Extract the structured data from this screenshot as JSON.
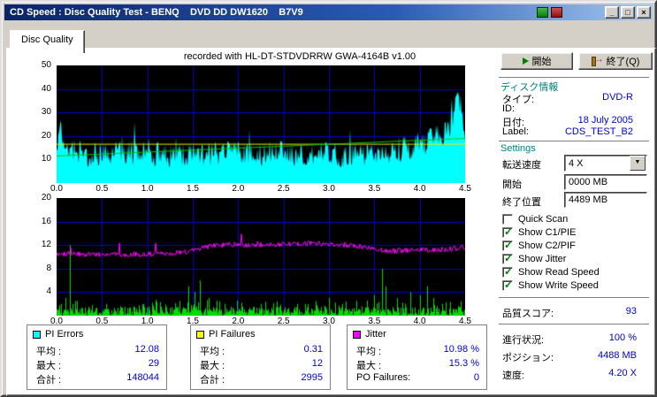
{
  "window": {
    "title": "CD Speed : Disc Quality Test - BENQ    DVD DD DW1620    B7V9"
  },
  "icons": {
    "minimize": "_",
    "maximize": "□",
    "close": "×",
    "dropdown": "▼",
    "check": "✓"
  },
  "tab": {
    "label": "Disc Quality"
  },
  "recorded_with": "recorded with HL-DT-STDVDRRW GWA-4164B v1.00",
  "buttons": {
    "start": "開始",
    "exit": "終了(Q)"
  },
  "disc_info": {
    "header": "ディスク情報",
    "rows": [
      {
        "label": "タイプ:",
        "value": "DVD-R"
      },
      {
        "label": "ID:",
        "value": ""
      },
      {
        "label": "日付:",
        "value": "18 July 2005"
      },
      {
        "label": "Label:",
        "value": "CDS_TEST_B2"
      }
    ]
  },
  "settings": {
    "header": "Settings",
    "speed_label": "転送速度",
    "speed_value": "4 X",
    "start_label": "開始",
    "start_value": "0000 MB",
    "end_label": "終了位置",
    "end_value": "4489 MB",
    "checkboxes": [
      {
        "label": "Quick Scan",
        "checked": false
      },
      {
        "label": "Show C1/PIE",
        "checked": true
      },
      {
        "label": "Show C2/PIF",
        "checked": true
      },
      {
        "label": "Show Jitter",
        "checked": true
      },
      {
        "label": "Show Read Speed",
        "checked": true
      },
      {
        "label": "Show Write Speed",
        "checked": true
      }
    ]
  },
  "quality": {
    "label": "品質スコア:",
    "value": "93"
  },
  "progress": {
    "rows": [
      {
        "label": "進行状況:",
        "value": "100 %"
      },
      {
        "label": "ポジション:",
        "value": "4488 MB"
      },
      {
        "label": "速度:",
        "value": "4.20 X"
      }
    ]
  },
  "stats_boxes": [
    {
      "title": "PI Errors",
      "swatch": "#00ffff",
      "rows": [
        {
          "label": "平均 :",
          "value": "12.08"
        },
        {
          "label": "最大 :",
          "value": "29"
        },
        {
          "label": "合計 :",
          "value": "148044"
        }
      ]
    },
    {
      "title": "PI Failures",
      "swatch": "#ffff00",
      "rows": [
        {
          "label": "平均 :",
          "value": "0.31"
        },
        {
          "label": "最大 :",
          "value": "12"
        },
        {
          "label": "合計 :",
          "value": "2995"
        }
      ]
    },
    {
      "title": "Jitter",
      "swatch": "#ff00ff",
      "rows": [
        {
          "label": "平均 :",
          "value": "10.98 %"
        },
        {
          "label": "最大 :",
          "value": "15.3 %"
        },
        {
          "label": "PO Failures:",
          "value": "0"
        }
      ]
    }
  ],
  "chart_data": [
    {
      "type": "area",
      "title": "PI Errors vs disc position",
      "x_range": [
        0,
        4.5
      ],
      "y_range": [
        0,
        50
      ],
      "x_ticks": [
        "0.0",
        "0.5",
        "1.0",
        "1.5",
        "2.0",
        "2.5",
        "3.0",
        "3.5",
        "4.0",
        "4.5"
      ],
      "y_ticks": [
        "50",
        "40",
        "30",
        "20",
        "10"
      ],
      "bg": "#000000",
      "grid_color": "#0000c8",
      "grid": true,
      "series": [
        {
          "name": "PI Errors",
          "kind": "noisy-area",
          "color": "#00ffff",
          "seed": 20050718,
          "noise": 5.5,
          "envelope": [
            [
              0,
              15
            ],
            [
              0.05,
              22
            ],
            [
              0.12,
              16
            ],
            [
              0.3,
              12
            ],
            [
              0.6,
              12
            ],
            [
              0.9,
              13
            ],
            [
              1.2,
              12
            ],
            [
              1.5,
              12
            ],
            [
              1.8,
              13
            ],
            [
              2.1,
              12
            ],
            [
              2.4,
              13
            ],
            [
              2.7,
              12
            ],
            [
              3.0,
              12
            ],
            [
              3.3,
              12
            ],
            [
              3.6,
              13
            ],
            [
              3.9,
              15
            ],
            [
              4.1,
              18
            ],
            [
              4.25,
              21
            ],
            [
              4.35,
              24
            ],
            [
              4.42,
              42
            ],
            [
              4.46,
              30
            ],
            [
              4.5,
              22
            ]
          ]
        },
        {
          "name": "Write Speed",
          "kind": "line",
          "color": "#e8e800",
          "points": [
            [
              0,
              16.5
            ],
            [
              4.5,
              16.5
            ]
          ]
        },
        {
          "name": "Read Speed",
          "kind": "line",
          "color": "#00c800",
          "points": [
            [
              0,
              11.5
            ],
            [
              4.5,
              19
            ]
          ]
        }
      ]
    },
    {
      "type": "mixed",
      "title": "PI Failures and Jitter vs disc position",
      "x_range": [
        0,
        4.5
      ],
      "y_range": [
        0,
        20
      ],
      "x_ticks": [
        "0.0",
        "0.5",
        "1.0",
        "1.5",
        "2.0",
        "2.5",
        "3.0",
        "3.5",
        "4.0",
        "4.5"
      ],
      "y_ticks": [
        "20",
        "16",
        "12",
        "8",
        "4"
      ],
      "bg": "#000000",
      "grid_color": "#0000c8",
      "grid": true,
      "series": [
        {
          "name": "PI Failures",
          "kind": "spikes",
          "color": "#00dc00",
          "seed": 41648,
          "grass": 1.5,
          "spikes": [
            [
              0.05,
              2
            ],
            [
              0.1,
              3
            ],
            [
              0.15,
              12
            ],
            [
              0.22,
              2.5
            ],
            [
              0.35,
              1.5
            ],
            [
              0.55,
              2
            ],
            [
              0.75,
              1.5
            ],
            [
              0.95,
              2
            ],
            [
              1.15,
              1.5
            ],
            [
              1.35,
              2.5
            ],
            [
              1.45,
              5
            ],
            [
              1.52,
              4
            ],
            [
              1.58,
              6
            ],
            [
              1.68,
              3
            ],
            [
              1.85,
              2
            ],
            [
              2.05,
              1.5
            ],
            [
              2.25,
              2
            ],
            [
              2.45,
              1.5
            ],
            [
              2.65,
              2
            ],
            [
              2.85,
              2.5
            ],
            [
              3.0,
              3
            ],
            [
              3.15,
              2
            ],
            [
              3.3,
              2.5
            ],
            [
              3.5,
              3.5
            ],
            [
              3.58,
              8
            ],
            [
              3.62,
              5
            ],
            [
              3.75,
              3
            ],
            [
              3.9,
              4
            ],
            [
              4.0,
              3.5
            ],
            [
              4.08,
              5
            ],
            [
              4.15,
              3
            ],
            [
              4.25,
              2
            ]
          ]
        },
        {
          "name": "Jitter",
          "kind": "noisy-line",
          "color": "#ff00ff",
          "seed": 1098,
          "noise": 0.9,
          "envelope": [
            [
              0,
              10.6
            ],
            [
              0.3,
              10.4
            ],
            [
              0.6,
              10.5
            ],
            [
              0.9,
              10.4
            ],
            [
              1.2,
              10.5
            ],
            [
              1.45,
              10.9
            ],
            [
              1.7,
              11.8
            ],
            [
              1.9,
              12.1
            ],
            [
              2.2,
              12.0
            ],
            [
              2.5,
              12.2
            ],
            [
              2.8,
              12.3
            ],
            [
              3.1,
              12.1
            ],
            [
              3.3,
              11.9
            ],
            [
              3.5,
              11.2
            ],
            [
              3.7,
              11.0
            ],
            [
              3.9,
              11.1
            ],
            [
              4.1,
              11.2
            ],
            [
              4.3,
              11.3
            ],
            [
              4.5,
              11.6
            ]
          ]
        }
      ]
    }
  ],
  "colors": {
    "window_face": "#d4d0c8",
    "section_teal": "#008080",
    "value_blue": "#0000cc",
    "titlebar_left": "#0a246a",
    "titlebar_right": "#a6caf0"
  }
}
